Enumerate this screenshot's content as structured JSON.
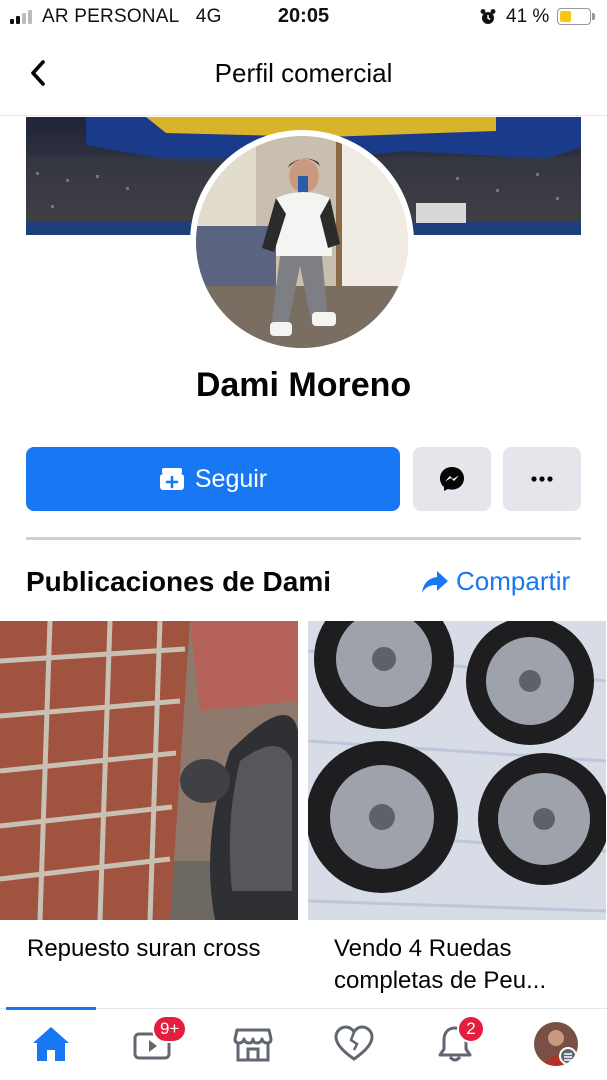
{
  "status_bar": {
    "carrier": "AR PERSONAL",
    "network": "4G",
    "time": "20:05",
    "battery_percent": "41 %",
    "battery_level": 0.41,
    "signal_bars": 2
  },
  "header": {
    "title": "Perfil comercial",
    "back_icon": "chevron-left-icon"
  },
  "profile": {
    "name": "Dami Moreno"
  },
  "actions": {
    "follow_label": "Seguir",
    "follow_icon": "follow-plus-icon",
    "message_icon": "messenger-icon",
    "more_icon": "more-dots-icon"
  },
  "posts_section": {
    "title": "Publicaciones de Dami",
    "share_label": "Compartir",
    "share_icon": "share-arrow-icon",
    "posts": [
      {
        "caption": "Repuesto suran cross"
      },
      {
        "caption": "Vendo 4 Ruedas completas de Peu..."
      }
    ]
  },
  "tab_bar": {
    "tabs": [
      {
        "name": "home",
        "icon": "home-icon",
        "active": true
      },
      {
        "name": "watch",
        "icon": "video-icon",
        "badge": "9+"
      },
      {
        "name": "marketplace",
        "icon": "marketplace-icon"
      },
      {
        "name": "dating",
        "icon": "heart-icon"
      },
      {
        "name": "notifications",
        "icon": "bell-icon",
        "badge": "2"
      },
      {
        "name": "profile-menu",
        "icon": "avatar-icon"
      }
    ]
  },
  "colors": {
    "accent": "#1877f2",
    "badge": "#e41e3f",
    "secondary_button": "#e4e6eb"
  }
}
